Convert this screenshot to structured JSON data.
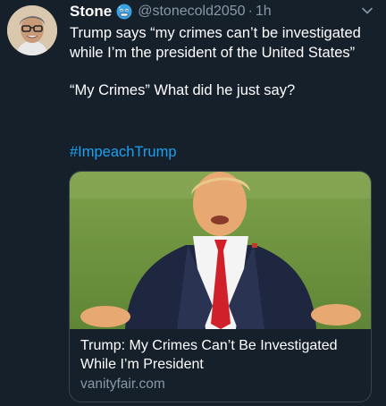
{
  "tweet": {
    "author_name": "Stone",
    "emoji_icon": "cold-face-emoji-icon",
    "handle": "@stonecold2050",
    "separator": "·",
    "time": "1h",
    "text_line1": "Trump says “my crimes can’t be investigated while I’m the president of the United States”",
    "text_line2": "“My Crimes” What did he just say?",
    "hashtag": "#ImpeachTrump"
  },
  "card": {
    "title": "Trump: My Crimes Can’t Be Investigated While I’m President",
    "domain": "vanityfair.com"
  },
  "colors": {
    "background": "#15202b",
    "text": "#ffffff",
    "secondary": "#8899a6",
    "link": "#1da1f2",
    "border": "#38444d"
  }
}
